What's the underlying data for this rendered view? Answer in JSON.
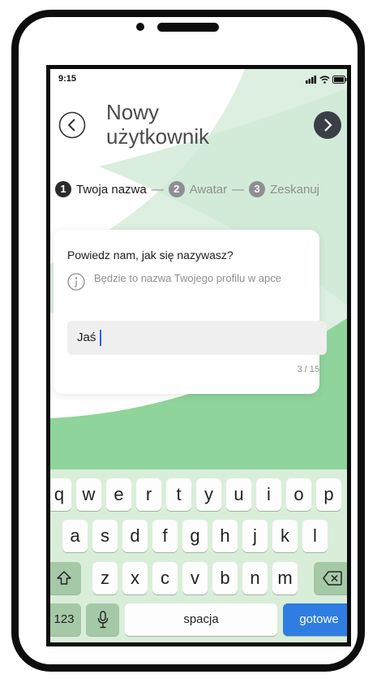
{
  "status_bar": {
    "time": "9:15"
  },
  "header": {
    "title": "Nowy użytkownik"
  },
  "steps": [
    {
      "num": "1",
      "label": "Twoja nazwa",
      "active": true
    },
    {
      "num": "2",
      "label": "Awatar",
      "active": false
    },
    {
      "num": "3",
      "label": "Zeskanuj",
      "active": false
    }
  ],
  "steps_separator": "—",
  "card": {
    "question": "Powiedz nam, jak się nazywasz?",
    "hint": "Będzie to nazwa Twojego profilu w apce",
    "input_value": "Jaś",
    "counter": "3 / 15"
  },
  "keyboard": {
    "row1": [
      "q",
      "w",
      "e",
      "r",
      "t",
      "y",
      "u",
      "i",
      "o",
      "p"
    ],
    "row2": [
      "a",
      "s",
      "d",
      "f",
      "g",
      "h",
      "j",
      "k",
      "l"
    ],
    "row3": [
      "z",
      "x",
      "c",
      "v",
      "b",
      "n",
      "m"
    ],
    "numbers_key": "123",
    "space_key": "spacja",
    "done_key": "gotowe"
  },
  "colors": {
    "accent_green": "#8fd49a",
    "done_blue": "#2f7de2",
    "keyboard_bg": "#d9eed9"
  }
}
